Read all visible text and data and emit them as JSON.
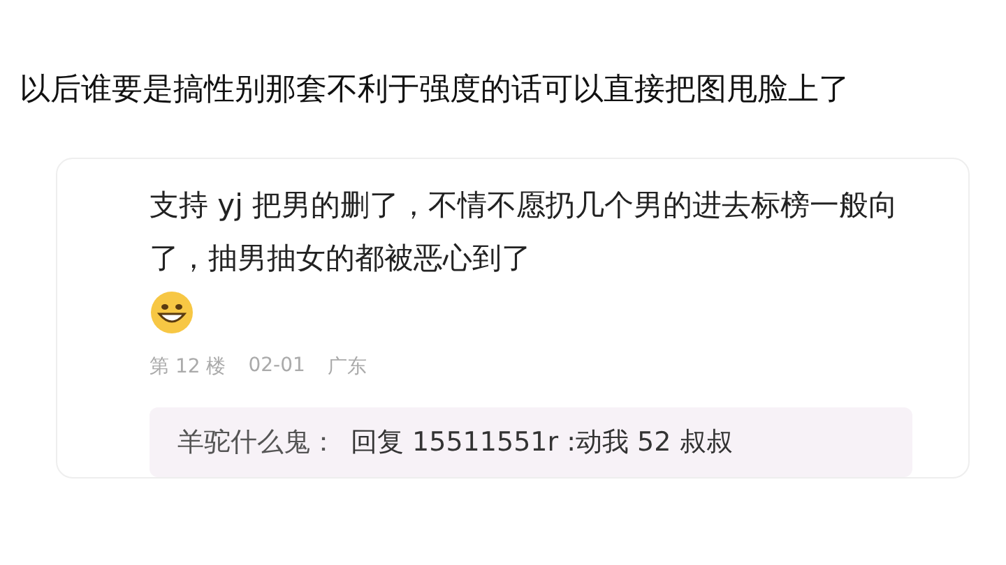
{
  "post": {
    "text": "以后谁要是搞性别那套不利于强度的话可以直接把图甩脸上了"
  },
  "comment": {
    "text": "支持 yj 把男的删了，不情不愿扔几个男的进去标榜一般向了，抽男抽女的都被恶心到了",
    "meta": [
      "第 12 楼",
      "02-01",
      "广东"
    ],
    "reply": {
      "author": "羊驼什么鬼：",
      "text": "回复 15511551r :动我 52 叔叔"
    }
  }
}
